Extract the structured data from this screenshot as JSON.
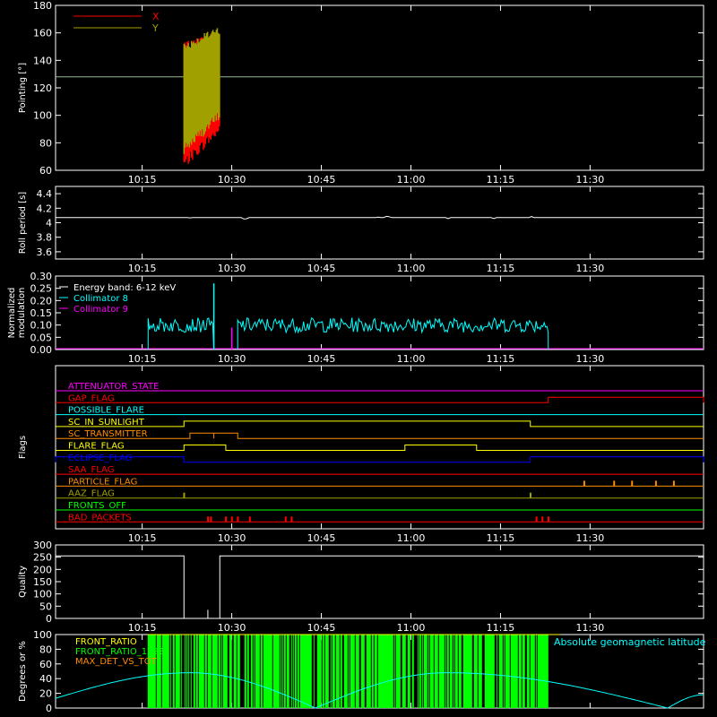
{
  "chart_data": [
    {
      "type": "line",
      "ylabel": "Pointing [°]",
      "ylim": [
        60,
        180
      ],
      "yticks": [
        60,
        80,
        100,
        120,
        140,
        160,
        180
      ],
      "xlim_minutes": [
        600,
        650
      ],
      "xticks": [
        "10:15",
        "10:30",
        "10:45",
        "11:00",
        "11:15",
        "11:30"
      ],
      "xtick_minutes": [
        615,
        630,
        645,
        660,
        675,
        690
      ],
      "reference_line": 128,
      "reference_color": "#8fbc8f",
      "legend": [
        {
          "name": "X",
          "color": "#ff0000"
        },
        {
          "name": "Y",
          "color": "#a0a000"
        }
      ],
      "series": [
        {
          "name": "X",
          "color": "#ff0000",
          "t_range": [
            "10:22",
            "10:28"
          ],
          "low": [
            65,
            90
          ],
          "high": [
            150,
            160
          ]
        },
        {
          "name": "Y",
          "color": "#a0a000",
          "t_range": [
            "10:22",
            "10:28"
          ],
          "low": [
            75,
            100
          ],
          "high": [
            150,
            162
          ]
        }
      ]
    },
    {
      "type": "line",
      "ylabel": "Roll period [s]",
      "ylim": [
        3.5,
        4.5
      ],
      "yticks": [
        3.6,
        3.8,
        4.0,
        4.2,
        4.4
      ],
      "xticks": [
        "10:15",
        "10:30",
        "10:45",
        "11:00",
        "11:15",
        "11:30"
      ],
      "series": [
        {
          "name": "",
          "color": "#ffffff",
          "value": 4.07
        }
      ]
    },
    {
      "type": "line",
      "ylabel": "Normalized modulation",
      "ylim": [
        0,
        0.3
      ],
      "yticks": [
        "0.00",
        "0.05",
        "0.10",
        "0.15",
        "0.20",
        "0.25",
        "0.30"
      ],
      "xticks": [
        "10:15",
        "10:30",
        "10:45",
        "11:00",
        "11:15",
        "11:30"
      ],
      "legend": [
        {
          "name": "Energy band: 6-12 keV",
          "color": "#ffffff"
        },
        {
          "name": "Collimator 8",
          "color": "#00ffff"
        },
        {
          "name": "Collimator 9",
          "color": "#ff00ff"
        }
      ],
      "series": [
        {
          "name": "Collimator 8",
          "color": "#00ffff",
          "segments": [
            [
              "10:16",
              "10:27"
            ],
            [
              "10:31",
              "11:23"
            ]
          ],
          "level": 0.1,
          "spike": {
            "t": "10:27",
            "value": 0.27
          }
        },
        {
          "name": "Collimator 9",
          "color": "#ff00ff",
          "spike": {
            "t": "10:30",
            "value": 0.09
          }
        }
      ]
    },
    {
      "type": "line",
      "ylabel": "Flags",
      "xticks": [
        "10:15",
        "10:30",
        "10:45",
        "11:00",
        "11:15",
        "11:30"
      ],
      "flags": [
        {
          "name": "ATTENUATOR_STATE",
          "color": "#ff00ff",
          "events": []
        },
        {
          "name": "GAP_FLAG",
          "color": "#ff0000",
          "events": [
            [
              "11:23",
              "11:50"
            ]
          ]
        },
        {
          "name": "POSSIBLE_FLARE",
          "color": "#00ffff",
          "events": []
        },
        {
          "name": "SC_IN_SUNLIGHT",
          "color": "#ffff00",
          "events": [
            [
              "10:22",
              "11:20"
            ]
          ]
        },
        {
          "name": "SC_TRANSMITTER",
          "color": "#ff8c00",
          "events": [
            [
              "10:23",
              "10:27"
            ],
            [
              "10:27",
              "10:31"
            ]
          ]
        },
        {
          "name": "FLARE_FLAG",
          "color": "#ffff00",
          "events": [
            [
              "10:22",
              "10:29"
            ],
            [
              "10:59",
              "11:11"
            ]
          ]
        },
        {
          "name": "ECLIPSE_FLAG",
          "color": "#0000ff",
          "events": [
            [
              "10:00",
              "10:22"
            ],
            [
              "11:20",
              "11:50"
            ]
          ]
        },
        {
          "name": "SAA_FLAG",
          "color": "#ff0000",
          "events": []
        },
        {
          "name": "PARTICLE_FLAG",
          "color": "#ff8c00",
          "ticks": [
            "11:29",
            "11:34",
            "11:37",
            "11:41",
            "11:44"
          ]
        },
        {
          "name": "AAZ_FLAG",
          "color": "#a0a000",
          "ticks": [
            "10:22",
            "11:20"
          ]
        },
        {
          "name": "FRONTS_OFF",
          "color": "#00ff00",
          "events": []
        },
        {
          "name": "BAD_PACKETS",
          "color": "#ff0000",
          "ticks": [
            "10:26",
            "10:26.5",
            "10:29",
            "10:30",
            "10:31",
            "10:33",
            "10:39",
            "10:40",
            "11:21",
            "11:22",
            "11:23"
          ]
        }
      ]
    },
    {
      "type": "line",
      "ylabel": "Quality",
      "ylim": [
        0,
        300
      ],
      "yticks": [
        0,
        50,
        100,
        150,
        200,
        250,
        300
      ],
      "xticks": [
        "10:15",
        "10:30",
        "10:45",
        "11:00",
        "11:15",
        "11:30"
      ],
      "series": [
        {
          "name": "",
          "color": "#ffffff",
          "value": 255,
          "gap": [
            "10:22",
            "10:28"
          ],
          "spike": {
            "t": "10:26",
            "value": 35
          }
        }
      ]
    },
    {
      "type": "line",
      "ylabel": "Degrees or %",
      "ylim": [
        0,
        100
      ],
      "yticks": [
        0,
        20,
        40,
        60,
        80,
        100
      ],
      "legend": [
        {
          "name": "FRONT_RATIO",
          "color": "#ffff00"
        },
        {
          "name": "FRONT_RATIO_1223",
          "color": "#00ff00"
        },
        {
          "name": "MAX_DET_VS_TOT",
          "color": "#ff8c00"
        },
        {
          "name": "Absolute geomagnetic latitude",
          "color": "#00ffff"
        }
      ],
      "series": [
        {
          "name": "Absolute geomagnetic latitude",
          "color": "#00ffff",
          "peaks": [
            [
              "10:23",
              48
            ],
            [
              "11:06",
              48
            ]
          ],
          "troughs": [
            [
              "10:44",
              0
            ],
            [
              "11:43",
              0
            ]
          ]
        },
        {
          "name": "FRONT_RATIO_1223",
          "color": "#00ff00",
          "t_range": [
            "10:16",
            "11:23"
          ],
          "value": 100
        }
      ]
    }
  ]
}
